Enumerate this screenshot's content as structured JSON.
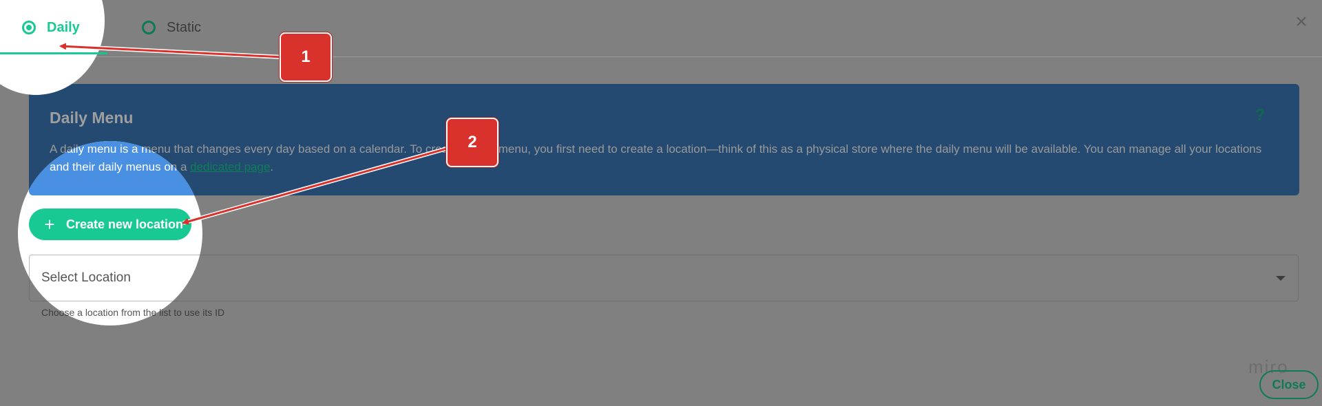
{
  "tabs": [
    {
      "label": "Daily",
      "selected": true
    },
    {
      "label": "Static",
      "selected": false
    }
  ],
  "info": {
    "title": "Daily Menu",
    "help": "?",
    "body_text": "A daily menu is a menu that changes every day based on a calendar. To create a daily menu, you first need to create a location—think of this as a physical store where the daily menu will be available. You can manage all your locations and their daily menus on a",
    "link_text": "dedicated page",
    "body_end": "."
  },
  "create_button": {
    "label": "Create new location",
    "icon": "plus-icon"
  },
  "location_select": {
    "placeholder": "Select Location",
    "hint": "Choose a location from the list to use its ID"
  },
  "watermark": "miro",
  "close_button": {
    "label": "Close"
  },
  "close_icon": "close-icon",
  "annotations": [
    {
      "number": "1"
    },
    {
      "number": "2"
    }
  ],
  "colors": {
    "accent": "#19c994",
    "info_box": "#4a90e2",
    "annotation": "#d9312b",
    "overlay": "#808080"
  }
}
